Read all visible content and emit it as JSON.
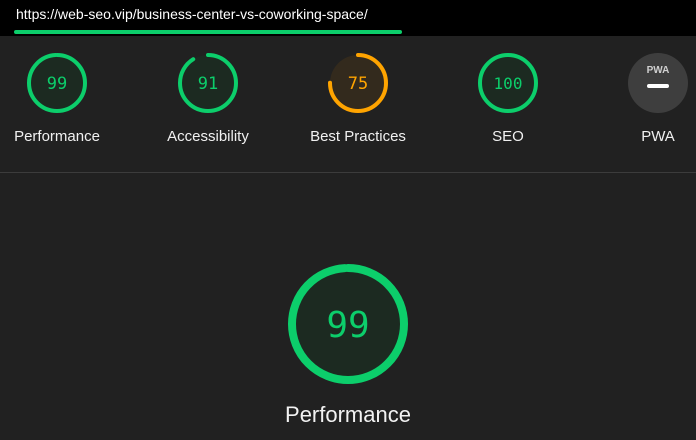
{
  "address_bar": {
    "url": "https://web-seo.vip/business-center-vs-coworking-space/",
    "load_progress": 1.0
  },
  "categories": [
    {
      "key": "performance",
      "label": "Performance",
      "score": "99",
      "color": "#0cce6b",
      "fill": "#1c2a21",
      "fraction": 0.99
    },
    {
      "key": "accessibility",
      "label": "Accessibility",
      "score": "91",
      "color": "#0cce6b",
      "fill": "#1c2a21",
      "fraction": 0.91
    },
    {
      "key": "best-practices",
      "label": "Best Practices",
      "score": "75",
      "color": "#ffa400",
      "fill": "#332a1d",
      "fraction": 0.75
    },
    {
      "key": "seo",
      "label": "SEO",
      "score": "100",
      "color": "#0cce6b",
      "fill": "#1c2a21",
      "fraction": 1.0
    },
    {
      "key": "pwa",
      "label": "PWA",
      "badge": "PWA",
      "icon": "pwa-badge-icon",
      "color": "#3e3e3e"
    }
  ],
  "main": {
    "label": "Performance",
    "score": "99",
    "fraction": 0.99,
    "color": "#0cce6b",
    "fill": "#1c2a21"
  }
}
